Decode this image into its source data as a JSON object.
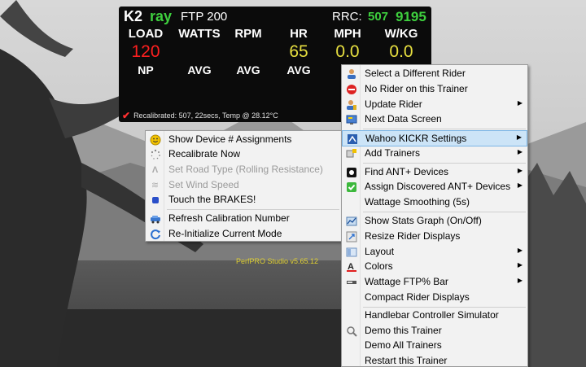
{
  "panel": {
    "rider_number": "K2",
    "rider_name": "ray",
    "ftp": "FTP 200",
    "rrc_label": "RRC:",
    "rrc_value1": "507",
    "rrc_value2": "9195",
    "headers": [
      "LOAD",
      "WATTS",
      "RPM",
      "HR",
      "MPH",
      "W/KG"
    ],
    "values": [
      "120",
      "",
      "",
      "65",
      "0.0",
      "0.0"
    ],
    "labels2": [
      "NP",
      "AVG",
      "AVG",
      "AVG",
      "A"
    ],
    "recalibrated": "Recalibrated: 507, 22secs, Temp @ 28.12°C",
    "version": "PerfPRO Studio v5.65.12"
  },
  "main_menu": {
    "items": [
      {
        "label": "Select a Different Rider",
        "icon": "rider-icon",
        "submenu": false
      },
      {
        "label": "No Rider on this Trainer",
        "icon": "no-entry-icon",
        "submenu": false
      },
      {
        "label": "Update Rider",
        "icon": "user-edit-icon",
        "submenu": true
      },
      {
        "label": "Next Data Screen",
        "icon": "screen-icon",
        "submenu": false
      },
      {
        "label": "Wahoo KICKR Settings",
        "icon": "kickr-icon",
        "submenu": true,
        "highlighted": true
      },
      {
        "label": "Add Trainers",
        "icon": "add-trainer-icon",
        "submenu": true
      },
      {
        "label": "Find ANT+ Devices",
        "icon": "ant-icon",
        "submenu": true
      },
      {
        "label": "Assign Discovered ANT+ Devices",
        "icon": "check-icon",
        "submenu": true
      },
      {
        "label": "Wattage Smoothing (5s)",
        "icon": "",
        "submenu": false
      },
      {
        "label": "Show Stats Graph (On/Off)",
        "icon": "graph-icon",
        "submenu": false
      },
      {
        "label": "Resize Rider Displays",
        "icon": "resize-icon",
        "submenu": false
      },
      {
        "label": "Layout",
        "icon": "layout-icon",
        "submenu": true
      },
      {
        "label": "Colors",
        "icon": "colors-icon",
        "submenu": true
      },
      {
        "label": "Wattage FTP% Bar",
        "icon": "bar-icon",
        "submenu": true
      },
      {
        "label": "Compact Rider Displays",
        "icon": "",
        "submenu": false
      },
      {
        "label": "Handlebar Controller Simulator",
        "icon": "",
        "submenu": false
      },
      {
        "label": "Demo this Trainer",
        "icon": "demo-icon",
        "submenu": false
      },
      {
        "label": "Demo All Trainers",
        "icon": "",
        "submenu": false
      },
      {
        "label": "Restart this Trainer",
        "icon": "",
        "submenu": false
      }
    ]
  },
  "sub_menu": {
    "items": [
      {
        "label": "Show Device # Assignments",
        "icon": "smiley-icon",
        "disabled": false
      },
      {
        "label": "Recalibrate Now",
        "icon": "spinner-icon",
        "disabled": false
      },
      {
        "label": "Set Road Type (Rolling Resistance)",
        "icon": "road-icon",
        "disabled": true
      },
      {
        "label": "Set Wind Speed",
        "icon": "wind-icon",
        "disabled": true
      },
      {
        "label": "Touch the BRAKES!",
        "icon": "brake-icon",
        "disabled": false
      },
      {
        "label": "Refresh Calibration Number",
        "icon": "refresh-car-icon",
        "disabled": false
      },
      {
        "label": "Re-Initialize Current Mode",
        "icon": "reinit-icon",
        "disabled": false
      }
    ]
  }
}
